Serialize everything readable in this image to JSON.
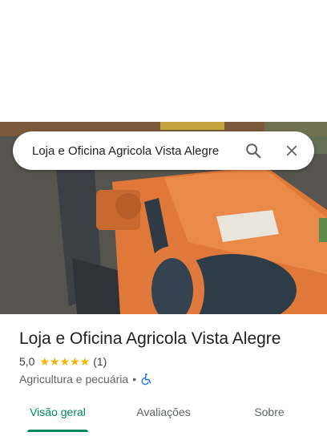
{
  "search": {
    "query": "Loja e Oficina Agricola Vista Alegre",
    "search_icon": "search-icon",
    "close_icon": "close-icon"
  },
  "place": {
    "name": "Loja e Oficina Agricola Vista Alegre",
    "rating": "5,0",
    "stars": "★★★★★",
    "review_count": "(1)",
    "category": "Agricultura e pecuária",
    "separator": "•",
    "accessibility_icon": "wheelchair-accessible-icon"
  },
  "tabs": [
    {
      "label": "Visão geral",
      "active": true
    },
    {
      "label": "Avaliações",
      "active": false
    },
    {
      "label": "Sobre",
      "active": false
    }
  ],
  "colors": {
    "accent": "#01875f",
    "star": "#f4b400",
    "accessibility": "#1a73e8"
  }
}
